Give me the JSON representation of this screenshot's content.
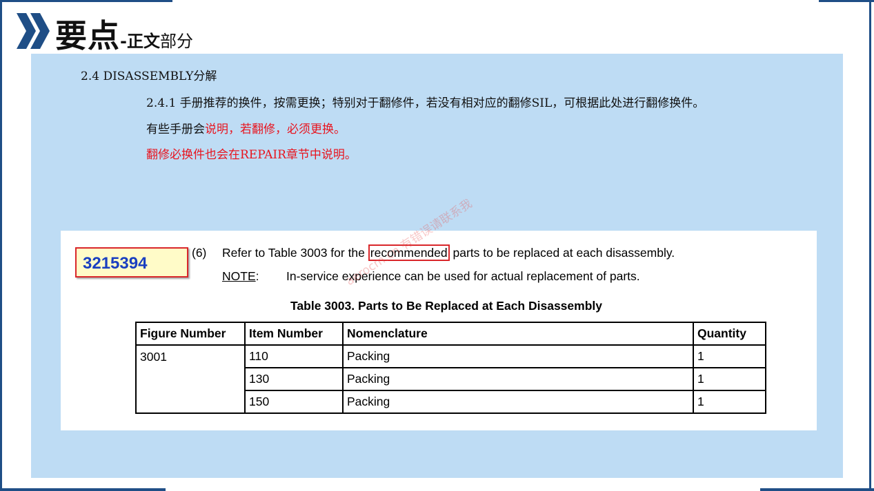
{
  "header": {
    "title_main": "要点",
    "title_dash": "-",
    "title_mid": "正文",
    "title_small": "部分"
  },
  "section": {
    "heading": "2.4 DISASSEMBLY分解",
    "para1": "2.4.1 手册推荐的换件，按需更换；特别对于翻修件，若没有相对应的翻修SIL，可根据此处进行翻修换件。",
    "para2_black": "有些手册会",
    "para2_red": "说明，若翻修，必须更换。",
    "para3_red": "翻修必换件也会在REPAIR章节中说明。"
  },
  "excerpt": {
    "part_number": "3215394",
    "step_number": "(6)",
    "step_before": "Refer to Table 3003 for the ",
    "step_highlight": "recommended",
    "step_after": " parts to be replaced at each disassembly.",
    "note_label": "NOTE",
    "note_colon": ":",
    "note_text": "In-service experience can be used for actual replacement of parts.",
    "table_title": "Table 3003. Parts to Be Replaced at Each Disassembly",
    "table_headers": [
      "Figure Number",
      "Item Number",
      "Nomenclature",
      "Quantity"
    ],
    "figure_number": "3001",
    "rows": [
      {
        "item": "110",
        "nomenclature": "Packing",
        "quantity": "1"
      },
      {
        "item": "130",
        "nomenclature": "Packing",
        "quantity": "1"
      },
      {
        "item": "150",
        "nomenclature": "Packing",
        "quantity": "1"
      }
    ]
  },
  "watermark": "aerocm.cn 有错误请联系我",
  "colors": {
    "accent_blue": "#1f4e86",
    "panel_bg": "#bedcf4",
    "highlight_red": "#e8141e"
  }
}
